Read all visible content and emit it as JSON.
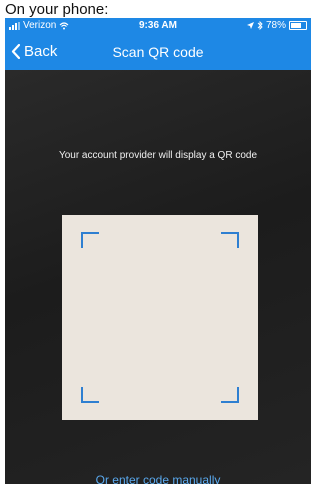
{
  "caption": "On your phone:",
  "status_bar": {
    "carrier": "Verizon",
    "time": "9:36 AM",
    "battery": "78%",
    "icons": [
      "signal-icon",
      "wifi-icon",
      "location-icon",
      "bluetooth-icon",
      "battery-icon"
    ]
  },
  "nav": {
    "back_label": "Back",
    "title": "Scan QR code"
  },
  "scanner": {
    "instruction": "Your account provider will display a QR code",
    "manual_link": "Or enter code manually"
  },
  "colors": {
    "accent": "#1e88e5",
    "link": "#5aa9ee",
    "frame": "#2e7fd1"
  }
}
